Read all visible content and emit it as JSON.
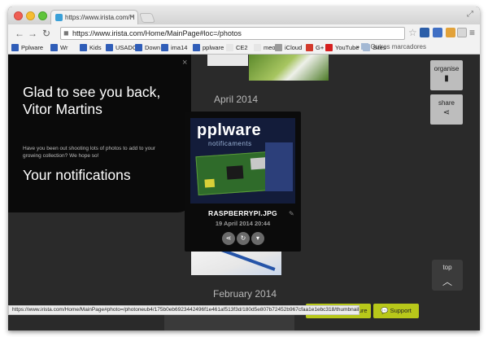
{
  "browser": {
    "tab_title": "https://www.irista.com/H",
    "url": "https://www.irista.com/Home/MainPage#loc=/photos",
    "bookmarks": [
      {
        "label": "Pplware",
        "icon": "blue-square-icon",
        "color": "#2f5db8"
      },
      {
        "label": "Wr",
        "icon": "blue-square-icon",
        "color": "#2f5db8"
      },
      {
        "label": "Kids",
        "icon": "blue-square-icon",
        "color": "#2f5db8"
      },
      {
        "label": "USADOS",
        "icon": "blue-square-icon",
        "color": "#2f5db8"
      },
      {
        "label": "Down",
        "icon": "blue-square-icon",
        "color": "#2f5db8"
      },
      {
        "label": "ima14",
        "icon": "blue-square-icon",
        "color": "#2f5db8"
      },
      {
        "label": "pplware",
        "icon": "blue-square-icon",
        "color": "#2f5db8"
      },
      {
        "label": "CE2",
        "icon": "page-icon",
        "color": "#e6e6e6"
      },
      {
        "label": "meo",
        "icon": "page-icon",
        "color": "#e6e6e6"
      },
      {
        "label": "iCloud",
        "icon": "apple-icon",
        "color": "#9a9a9a"
      },
      {
        "label": "G+",
        "icon": "red-square-icon",
        "color": "#d23a2c"
      },
      {
        "label": "YouTube",
        "icon": "youtube-icon",
        "color": "#d62020"
      },
      {
        "label": "Sites",
        "icon": "folder-icon",
        "color": "#a4b9d4"
      }
    ],
    "bookmarks_more": "Outros marcadores",
    "status_url": "https://www.irista.com/Home/MainPage#photo=/photoneub4/175b0eb6923442496f1e461af513f3d/180d5e807b72452b967cfaa1e1ebc318/thumbnail"
  },
  "notification": {
    "greeting": "Glad to see you back, Vitor Martins",
    "body": "Have you been out shooting lots of photos to add to your growing collection? We hope so!",
    "title": "Your notifications",
    "close": "×"
  },
  "months": {
    "april": "April 2014",
    "february": "February 2014"
  },
  "photo": {
    "logo": "pplware",
    "logo_sub": "notificaments",
    "filename": "RASPBERRYPI.JPG",
    "date": "19 April 2014 20:44",
    "actions": [
      "share-icon",
      "rotate-icon",
      "delete-icon"
    ]
  },
  "side": {
    "organise": "organise",
    "share": "share",
    "top": "top"
  },
  "footer": {
    "feature": "Request a feature",
    "support": "Support"
  },
  "colors": {
    "accent": "#b8c81a",
    "page_bg": "#2a2a2a",
    "panel_bg": "#0a0a0a"
  }
}
